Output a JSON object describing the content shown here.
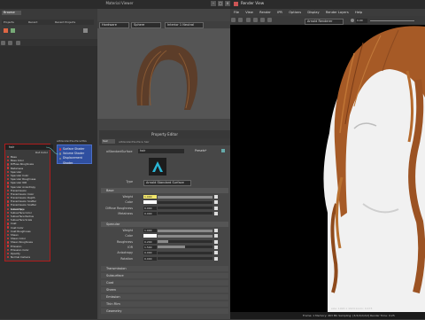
{
  "material_viewer": {
    "title": "Material Viewer",
    "left_panel_tab": "Browse",
    "tabs": [
      "Projects",
      "Recent",
      "Recent Projects"
    ],
    "renderer": "Hardware",
    "shading_object": "Sphere",
    "env": "Interior 1 Neutral"
  },
  "node_graph": {
    "shader_node": {
      "title": "hair",
      "label": "Out Color",
      "attrs": [
        "Base",
        "Base Color",
        "Diffuse Roughness",
        "Metalness",
        "Specular",
        "Specular Color",
        "Specular Roughness",
        "Specular IOR",
        "Specular Anisotropy",
        "Transmission",
        "Transmission Color",
        "Transmission Depth",
        "Transmission Scatter",
        "Transmission Scatter Anisotropy",
        "Subsurface",
        "Subsurface Color",
        "Subsurface Radius",
        "Subsurface Scale",
        "Coat",
        "Coat Color",
        "Coat Roughness",
        "Sheen",
        "Sheen Color",
        "Sheen Roughness",
        "Emission",
        "Emission Color",
        "Opacity",
        "Normal Camera"
      ]
    },
    "sg_node": {
      "title": "aiStandardSurface3SG",
      "attrs": [
        "Surface Shader",
        "Volume Shader",
        "Displacement Shader"
      ]
    }
  },
  "property_editor": {
    "title": "Property Editor",
    "node_tab": "hair",
    "path": "aiStandardSurface hair",
    "type_label": "aiStandardSurface",
    "name_value": "hair",
    "presets_label": "Presets*",
    "type_row_label": "Type",
    "type_value": "Arnold Standard Surface",
    "base_section": "Base",
    "base_rows": [
      {
        "label": "Weight",
        "value": "1.000",
        "fill": 1.0
      },
      {
        "label": "Color",
        "value": "",
        "fill": 0.0
      },
      {
        "label": "Diffuse Roughness",
        "value": "0.000",
        "fill": 0.0
      },
      {
        "label": "Metalness",
        "value": "0.000",
        "fill": 0.0
      }
    ],
    "specular_section": "Specular",
    "specular_rows": [
      {
        "label": "Weight",
        "value": "1.000",
        "fill": 1.0
      },
      {
        "label": "Color",
        "value": "",
        "fill": 1.0
      },
      {
        "label": "Roughness",
        "value": "0.200",
        "fill": 0.2
      },
      {
        "label": "IOR",
        "value": "1.500",
        "fill": 0.5
      },
      {
        "label": "Anisotropy",
        "value": "0.000",
        "fill": 0.0
      },
      {
        "label": "Rotation",
        "value": "0.000",
        "fill": 0.0
      }
    ],
    "collapsed_sections": [
      "Transmission",
      "Subsurface",
      "Coat",
      "Sheen",
      "Emission",
      "Thin Film",
      "Geometry"
    ]
  },
  "render_view": {
    "title": "Render View",
    "menu": [
      "File",
      "View",
      "Render",
      "IPR",
      "Options",
      "Display",
      "Render Layers",
      "Help"
    ],
    "renderer_select": "Arnold Renderer",
    "exposure": "0.00",
    "status": "Frame: 1  Memory: 463 Mb  Sampling: [3/2/2/2/2/2]  Render Time: 0:25",
    "size_info": "size: 1024 x 1024  zoom: 0.473"
  },
  "colors": {
    "hair_main": "#a65a26",
    "hair_dark": "#5a2e14",
    "skin": "#f1f1f1",
    "node_border": "#b01c1c",
    "sg_node": "#2f4fa0"
  }
}
